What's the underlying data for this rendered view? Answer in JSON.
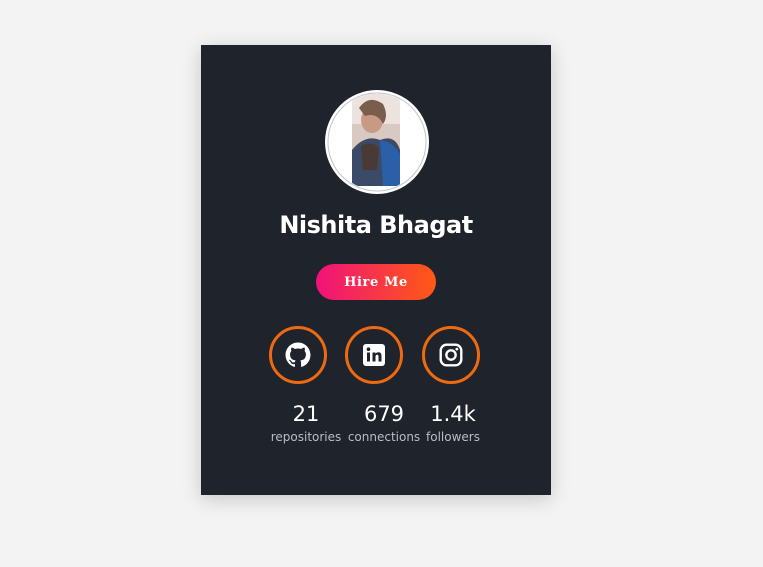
{
  "profile": {
    "name": "Nishita Bhagat",
    "hire_label": "Hire Me",
    "avatar_icon": "profile-photo"
  },
  "socials": [
    {
      "icon": "github-icon"
    },
    {
      "icon": "linkedin-icon"
    },
    {
      "icon": "instagram-icon"
    }
  ],
  "stats": [
    {
      "value": "21",
      "label": "repositories"
    },
    {
      "value": "679",
      "label": "connections"
    },
    {
      "value": "1.4k",
      "label": "followers"
    }
  ],
  "colors": {
    "page_bg": "#f3f3f3",
    "card_bg": "#1f232c",
    "accent_orange": "#ee6a10",
    "gradient_start": "#f0127a",
    "gradient_end": "#ff5a14"
  }
}
